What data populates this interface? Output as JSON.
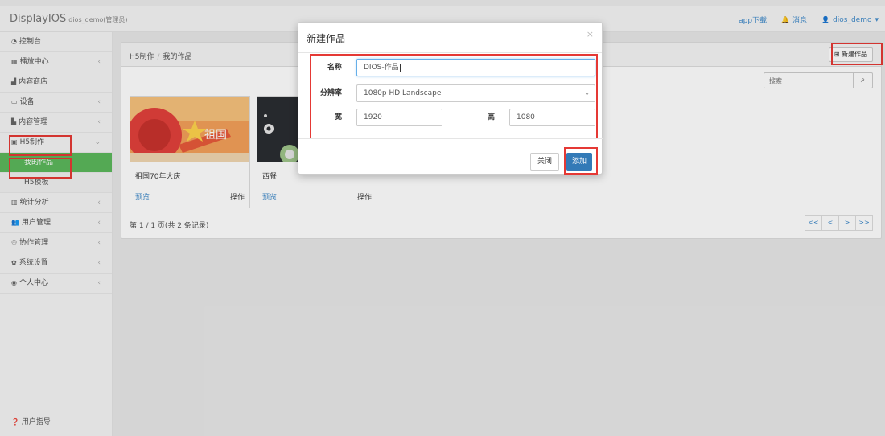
{
  "app": {
    "brand": "DisplayIOS",
    "brand_sub": "dios_demo(管理员)",
    "app_download": "app下载",
    "messages": "消息",
    "user": "dios_demo"
  },
  "sidebar": {
    "items": [
      {
        "label": "控制台",
        "icon": "dashboard-icon"
      },
      {
        "label": "播放中心",
        "icon": "grid-icon"
      },
      {
        "label": "内容商店",
        "icon": "store-icon"
      },
      {
        "label": "设备",
        "icon": "monitor-icon"
      },
      {
        "label": "内容管理",
        "icon": "content-icon"
      },
      {
        "label": "H5制作",
        "icon": "h5-icon"
      },
      {
        "label": "我的作品"
      },
      {
        "label": "H5模板"
      },
      {
        "label": "统计分析",
        "icon": "chart-icon"
      },
      {
        "label": "用户管理",
        "icon": "users-icon"
      },
      {
        "label": "协作管理",
        "icon": "cooperation-icon"
      },
      {
        "label": "系统设置",
        "icon": "gear-icon"
      },
      {
        "label": "个人中心",
        "icon": "user-circle-icon"
      }
    ],
    "guide": "用户指导"
  },
  "main": {
    "breadcrumb": [
      "H5制作",
      "我的作品"
    ],
    "new_work_label": "新建作品",
    "search_placeholder": "搜索",
    "cards": [
      {
        "title": "祖国70年大庆",
        "preview": "预览",
        "action": "操作"
      },
      {
        "title": "西餐",
        "preview": "预览",
        "action": "操作"
      }
    ],
    "pager_text": "第 1 / 1 页(共 2 条记录)",
    "pager_buttons": [
      "<<",
      "<",
      ">",
      ">>"
    ]
  },
  "modal": {
    "title": "新建作品",
    "close_glyph": "×",
    "name_label": "名称",
    "name_value": "DIOS-作品",
    "resolution_label": "分辨率",
    "resolution_value": "1080p HD Landscape",
    "width_label": "宽",
    "width_value": "1920",
    "height_label": "高",
    "height_value": "1080",
    "close_button": "关闭",
    "add_button": "添加"
  },
  "colors": {
    "active_green": "#5cb85c",
    "primary_blue": "#337ab7",
    "highlight_red": "#e53935",
    "link_blue": "#428bca"
  }
}
